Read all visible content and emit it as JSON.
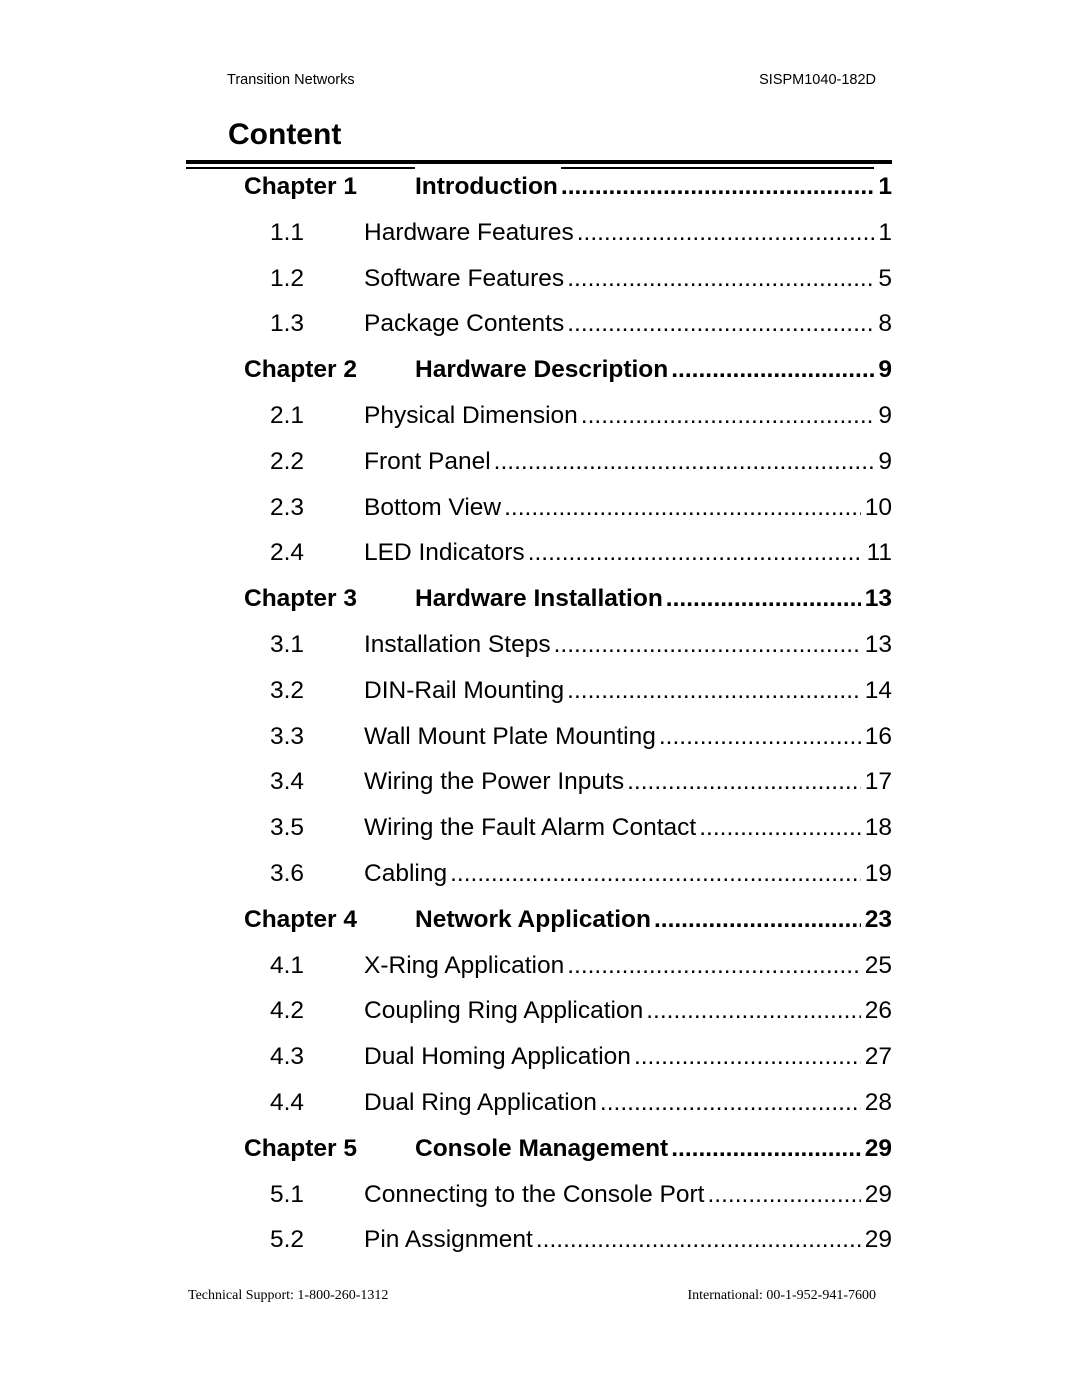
{
  "header": {
    "left": "Transition Networks",
    "right": "SISPM1040-182D"
  },
  "title": "Content",
  "toc": [
    {
      "type": "chapter",
      "num": "Chapter 1",
      "title": "Introduction",
      "page": "1"
    },
    {
      "type": "section",
      "num": "1.1",
      "title": "Hardware Features",
      "page": "1"
    },
    {
      "type": "section",
      "num": "1.2",
      "title": "Software Features",
      "page": "5"
    },
    {
      "type": "section",
      "num": "1.3",
      "title": "Package Contents",
      "page": "8"
    },
    {
      "type": "chapter",
      "num": "Chapter 2",
      "title": "Hardware Description",
      "page": "9"
    },
    {
      "type": "section",
      "num": "2.1",
      "title": "Physical Dimension",
      "page": "9"
    },
    {
      "type": "section",
      "num": "2.2",
      "title": "Front Panel",
      "page": "9"
    },
    {
      "type": "section",
      "num": "2.3",
      "title": "Bottom View",
      "page": "10"
    },
    {
      "type": "section",
      "num": "2.4",
      "title": "LED Indicators",
      "page": "11"
    },
    {
      "type": "chapter",
      "num": "Chapter 3",
      "title": "Hardware Installation",
      "page": "13"
    },
    {
      "type": "section",
      "num": "3.1",
      "title": "Installation Steps",
      "page": "13"
    },
    {
      "type": "section",
      "num": "3.2",
      "title": "DIN-Rail Mounting",
      "page": "14"
    },
    {
      "type": "section",
      "num": "3.3",
      "title": "Wall Mount Plate Mounting",
      "page": "16"
    },
    {
      "type": "section",
      "num": "3.4",
      "title": "Wiring the Power Inputs",
      "page": "17"
    },
    {
      "type": "section",
      "num": "3.5",
      "title": "Wiring the Fault Alarm Contact",
      "page": "18"
    },
    {
      "type": "section",
      "num": "3.6",
      "title": "Cabling",
      "page": "19"
    },
    {
      "type": "chapter",
      "num": "Chapter 4",
      "title": "Network Application",
      "page": "23"
    },
    {
      "type": "section",
      "num": "4.1",
      "title": "X-Ring Application",
      "page": "25"
    },
    {
      "type": "section",
      "num": "4.2",
      "title": "Coupling Ring Application",
      "page": "26"
    },
    {
      "type": "section",
      "num": "4.3",
      "title": "Dual Homing Application",
      "page": "27"
    },
    {
      "type": "section",
      "num": "4.4",
      "title": "Dual Ring Application",
      "page": "28"
    },
    {
      "type": "chapter",
      "num": "Chapter 5",
      "title": "Console Management",
      "page": "29"
    },
    {
      "type": "section",
      "num": "5.1",
      "title": "Connecting to the Console Port",
      "page": "29"
    },
    {
      "type": "section",
      "num": "5.2",
      "title": "Pin Assignment",
      "page": "29"
    }
  ],
  "footer": {
    "left": "Technical Support: 1-800-260-1312",
    "right": "International: 00-1-952-941-7600"
  }
}
